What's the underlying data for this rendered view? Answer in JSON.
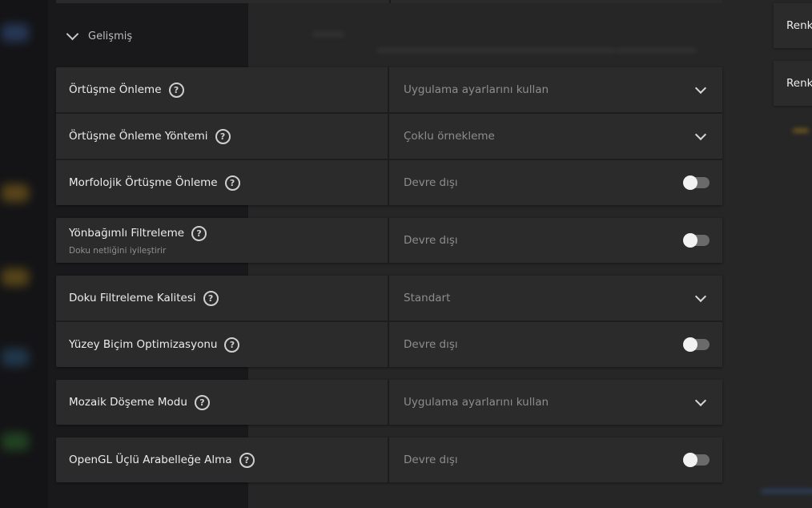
{
  "section": {
    "title": "Gelişmiş"
  },
  "groups": [
    {
      "rows": [
        {
          "label": "Örtüşme Önleme",
          "value": "Uygulama ayarlarını kullan",
          "control": "dropdown"
        },
        {
          "label": "Örtüşme Önleme Yöntemi",
          "value": "Çoklu örnekleme",
          "control": "dropdown"
        },
        {
          "label": "Morfolojik Örtüşme Önleme",
          "value": "Devre dışı",
          "control": "toggle",
          "on": false
        }
      ]
    },
    {
      "rows": [
        {
          "label": "Yönbağımlı Filtreleme",
          "sub": "Doku netliğini iyileştirir",
          "value": "Devre dışı",
          "control": "toggle",
          "on": false
        }
      ]
    },
    {
      "rows": [
        {
          "label": "Doku Filtreleme Kalitesi",
          "value": "Standart",
          "control": "dropdown"
        },
        {
          "label": "Yüzey Biçim Optimizasyonu",
          "value": "Devre dışı",
          "control": "toggle",
          "on": false
        }
      ]
    },
    {
      "rows": [
        {
          "label": "Mozaik Döşeme Modu",
          "value": "Uygulama ayarlarını kullan",
          "control": "dropdown"
        }
      ]
    },
    {
      "rows": [
        {
          "label": "OpenGL Üçlü Arabelleğe Alma",
          "value": "Devre dışı",
          "control": "toggle",
          "on": false
        }
      ]
    }
  ],
  "side_cards": [
    {
      "label": "Renk"
    },
    {
      "label": "Renk"
    }
  ],
  "help_glyph": "?",
  "colors": {
    "panel": "#2b2b2b",
    "background": "#1c1c1c",
    "toggle_off": "#6a6a6a"
  }
}
